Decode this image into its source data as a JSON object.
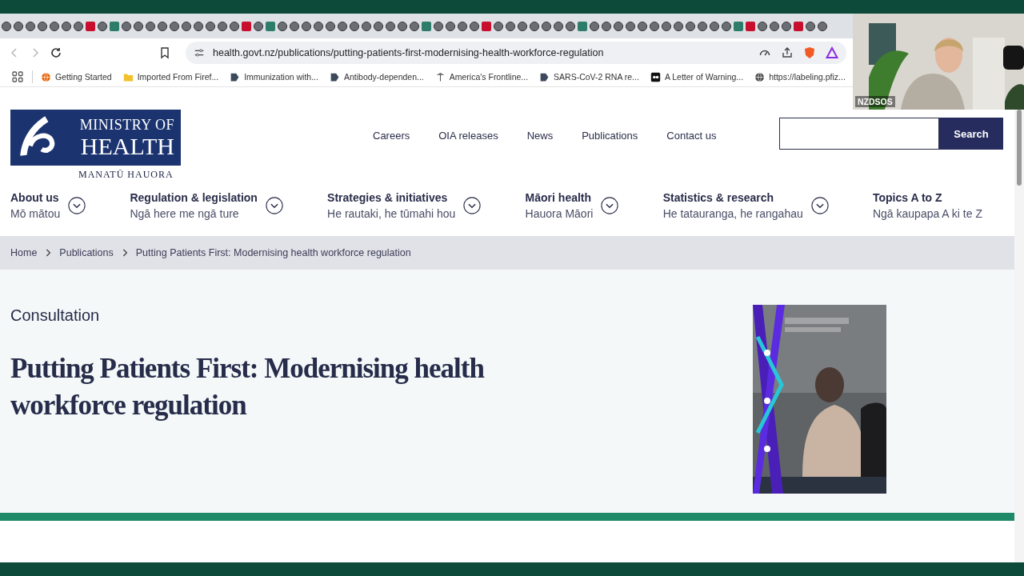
{
  "browser": {
    "address": "health.govt.nz/publications/putting-patients-first-modernising-health-workforce-regulation",
    "bookmarks": [
      {
        "label": "Getting Started"
      },
      {
        "label": "Imported From Firef..."
      },
      {
        "label": "Immunization with..."
      },
      {
        "label": "Antibody-dependen..."
      },
      {
        "label": "America's Frontline..."
      },
      {
        "label": "SARS-CoV-2 RNA re..."
      },
      {
        "label": "A Letter of Warning..."
      },
      {
        "label": "https://labeling.pfiz..."
      }
    ]
  },
  "webcam": {
    "label": "NZDSOS"
  },
  "site": {
    "logo": {
      "line1": "MINISTRY OF",
      "line2": "HEALTH",
      "subtitle": "MANATŪ HAUORA"
    },
    "top_links": [
      "Careers",
      "OIA releases",
      "News",
      "Publications",
      "Contact us"
    ],
    "search_button": "Search",
    "menu": [
      {
        "title": "About us",
        "subtitle": "Mō mātou",
        "expandable": true
      },
      {
        "title": "Regulation & legislation",
        "subtitle": "Ngā here me ngā ture",
        "expandable": true
      },
      {
        "title": "Strategies & initiatives",
        "subtitle": "He rautaki, he tūmahi hou",
        "expandable": true
      },
      {
        "title": "Māori health",
        "subtitle": "Hauora Māori",
        "expandable": true
      },
      {
        "title": "Statistics & research",
        "subtitle": "He tatauranga, he rangahau",
        "expandable": true
      },
      {
        "title": "Topics A to Z",
        "subtitle": "Ngā kaupapa A ki te Z",
        "expandable": false
      }
    ],
    "breadcrumb": [
      "Home",
      "Publications",
      "Putting Patients First: Modernising health workforce regulation"
    ],
    "eyebrow": "Consultation",
    "title": "Putting Patients First: Modernising health workforce regulation",
    "cover": {
      "kind": "picture"
    }
  }
}
